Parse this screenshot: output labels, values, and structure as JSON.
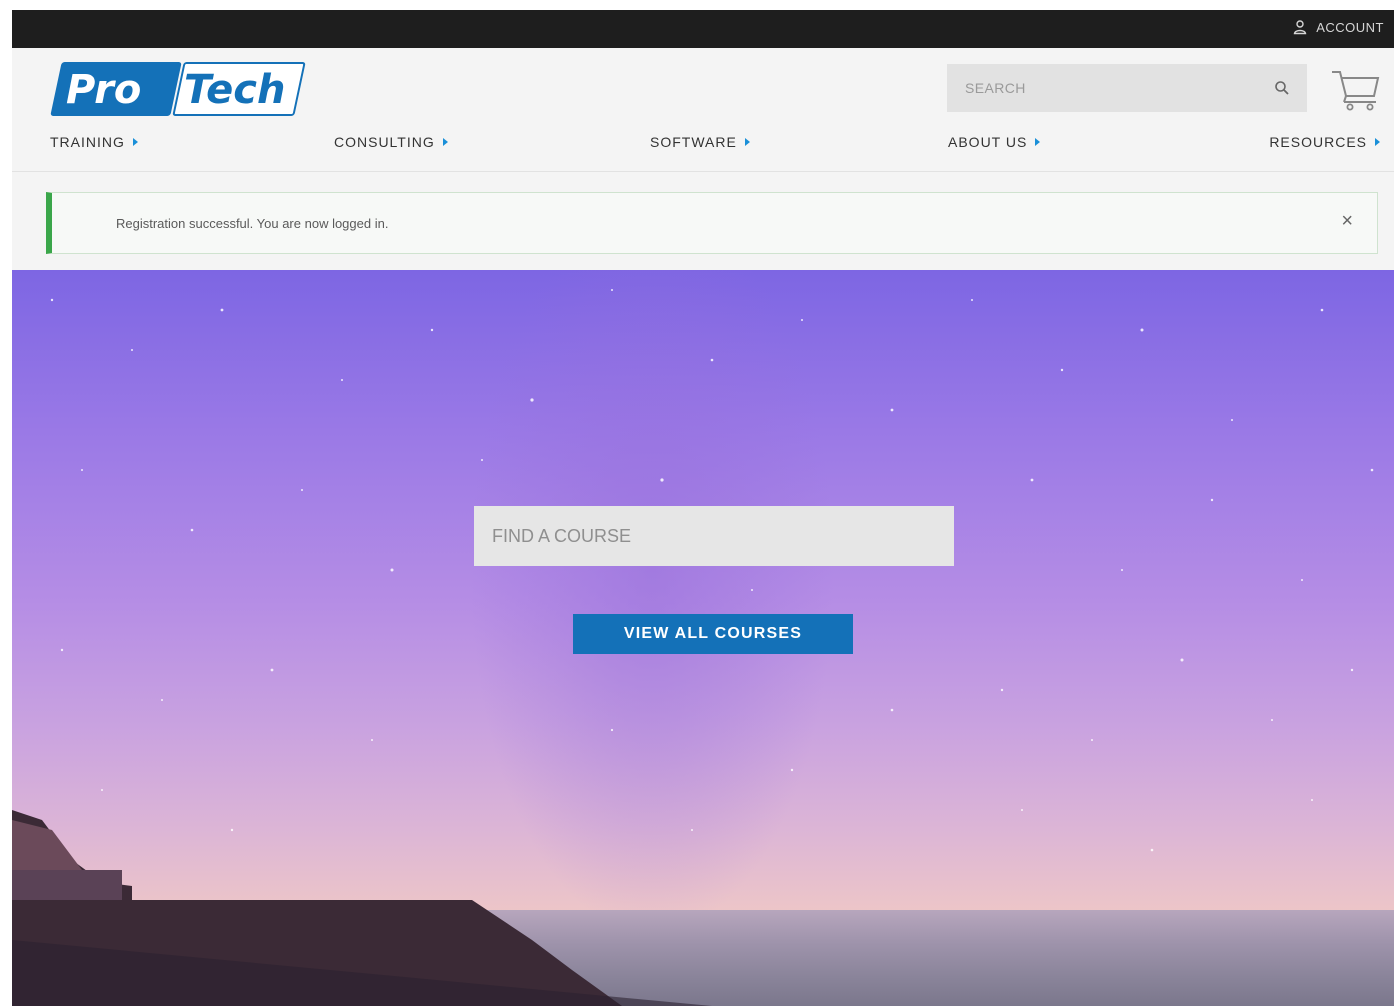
{
  "topbar": {
    "account_label": "ACCOUNT"
  },
  "header": {
    "logo": {
      "part1": "Pro",
      "part2": "Tech"
    },
    "search_placeholder": "SEARCH",
    "nav": [
      {
        "label": "TRAINING"
      },
      {
        "label": "CONSULTING"
      },
      {
        "label": "SOFTWARE"
      },
      {
        "label": "ABOUT US"
      },
      {
        "label": "RESOURCES"
      }
    ]
  },
  "alert": {
    "message": "Registration successful. You are now logged in.",
    "close_glyph": "×"
  },
  "hero": {
    "course_search_placeholder": "FIND A COURSE",
    "view_all_label": "VIEW ALL COURSES"
  },
  "colors": {
    "brand_blue": "#1471b8",
    "topbar": "#1e1e1e",
    "alert_green": "#3aa64a",
    "nav_arrow": "#1a8fd8"
  },
  "icons": {
    "account": "user-icon",
    "search": "search-icon",
    "cart": "cart-icon",
    "close": "close-icon"
  }
}
